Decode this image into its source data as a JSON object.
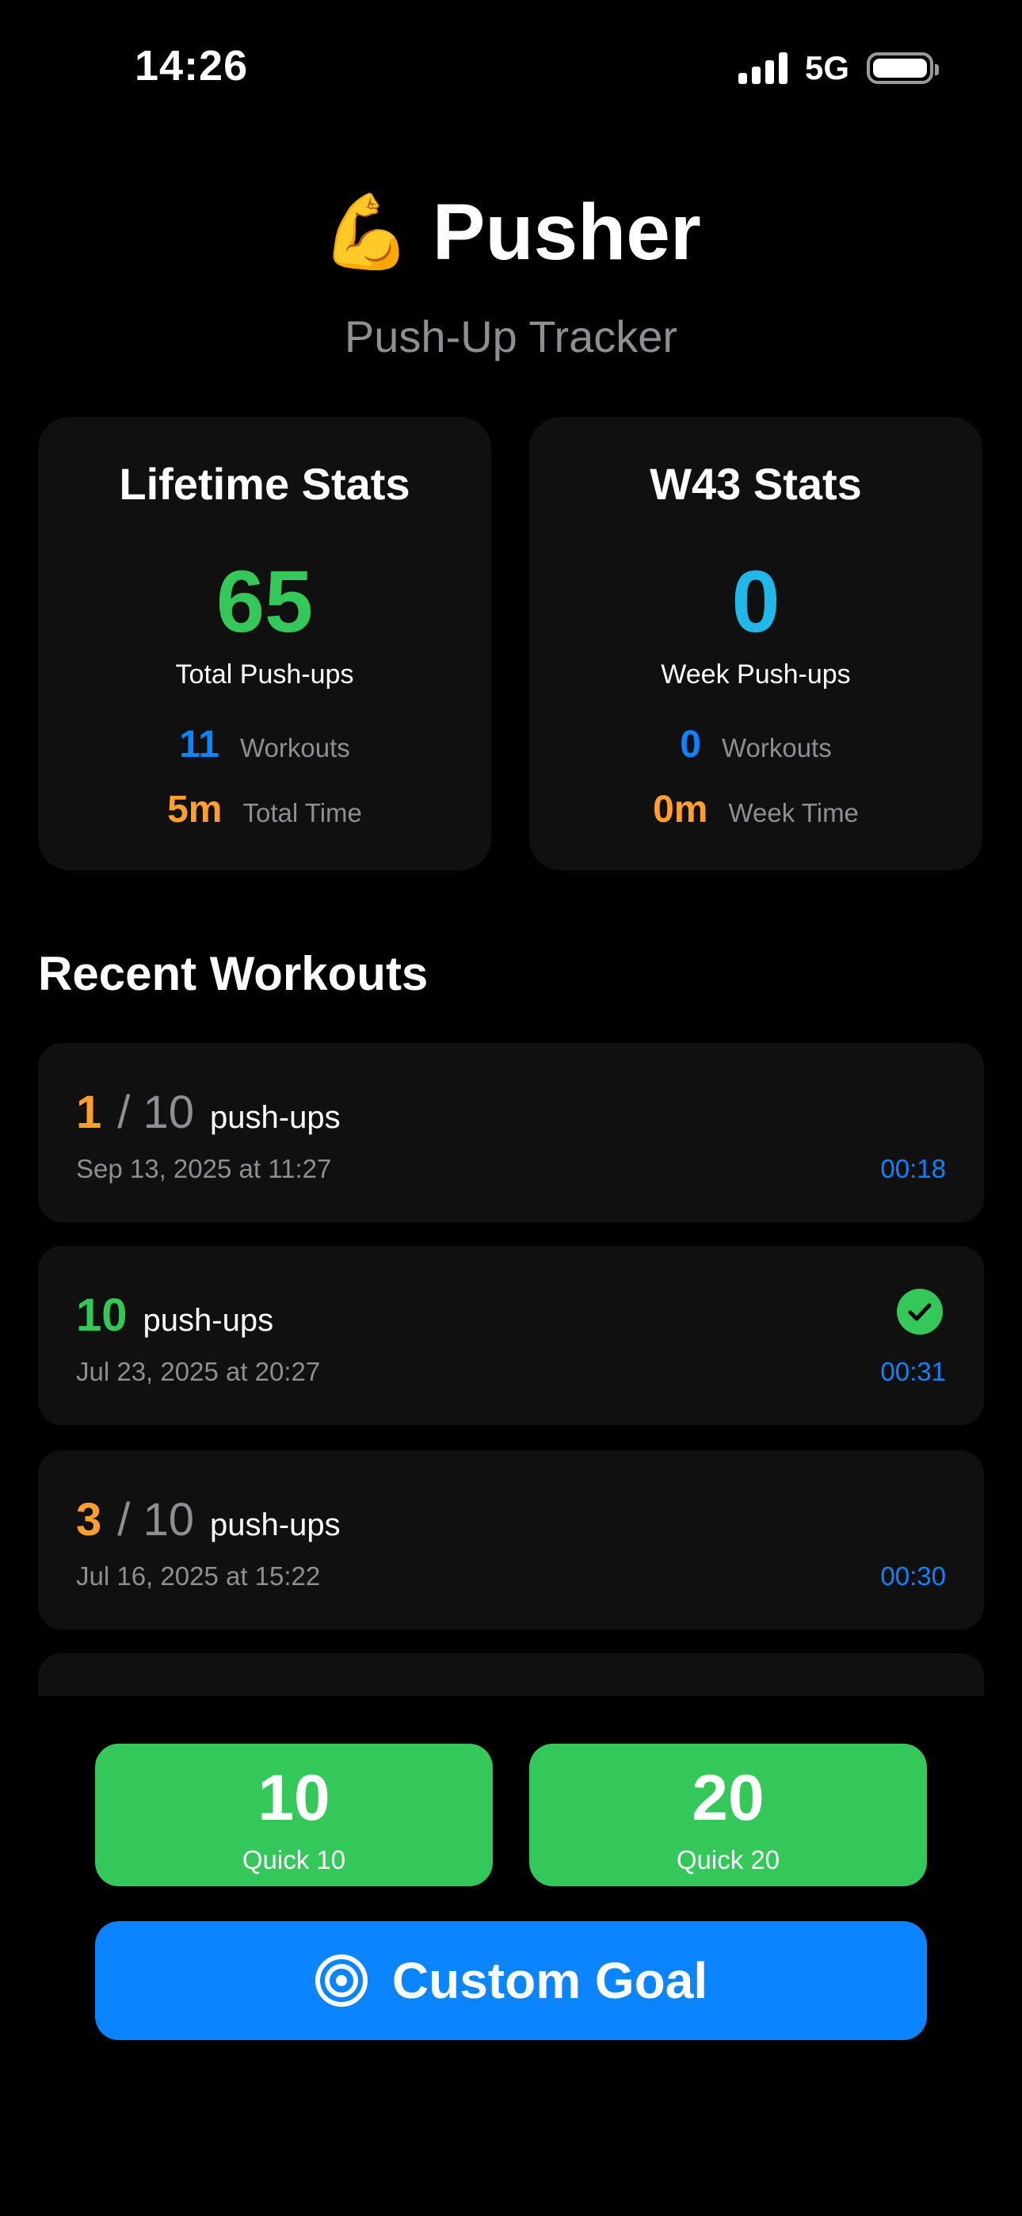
{
  "status_bar": {
    "time": "14:26",
    "network": "5G"
  },
  "header": {
    "emoji": "💪",
    "title": "Pusher",
    "subtitle": "Push-Up Tracker"
  },
  "lifetime": {
    "title": "Lifetime Stats",
    "total": "65",
    "total_label": "Total Push-ups",
    "workouts": "11",
    "workouts_label": "Workouts",
    "time": "5m",
    "time_label": "Total Time"
  },
  "week": {
    "title": "W43 Stats",
    "total": "0",
    "total_label": "Week Push-ups",
    "workouts": "0",
    "workouts_label": "Workouts",
    "time": "0m",
    "time_label": "Week Time"
  },
  "recent": {
    "title": "Recent Workouts",
    "items": [
      {
        "count": "1",
        "sep": "/",
        "goal": "10",
        "unit": "push-ups",
        "date": "Sep 13, 2025 at 11:27",
        "duration": "00:18",
        "completed": false
      },
      {
        "count": "10",
        "unit": "push-ups",
        "date": "Jul 23, 2025 at 20:27",
        "duration": "00:31",
        "completed": true
      },
      {
        "count": "3",
        "sep": "/",
        "goal": "10",
        "unit": "push-ups",
        "date": "Jul 16, 2025 at 15:22",
        "duration": "00:30",
        "completed": false
      }
    ]
  },
  "actions": {
    "quick10": {
      "value": "10",
      "label": "Quick 10"
    },
    "quick20": {
      "value": "20",
      "label": "Quick 20"
    },
    "custom": {
      "label": "Custom Goal",
      "icon": "target-icon"
    }
  },
  "colors": {
    "green": "#34c759",
    "blue": "#0a84ff",
    "cyan": "#1fb8e8",
    "orange": "#ff9f2e"
  }
}
